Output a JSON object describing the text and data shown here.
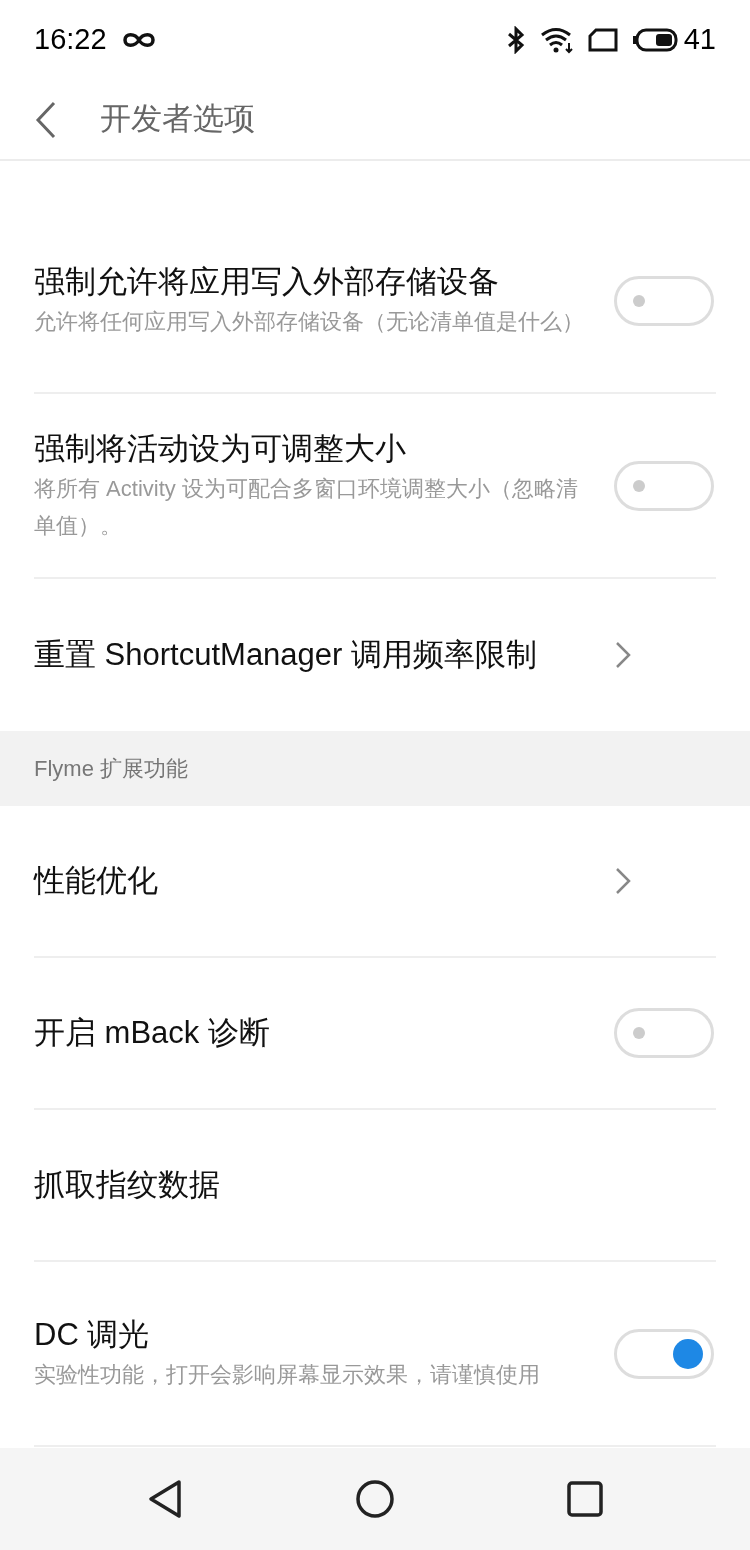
{
  "status_bar": {
    "time": "16:22",
    "battery": "41"
  },
  "header": {
    "title": "开发者选项"
  },
  "sections": [
    {
      "items": [
        {
          "kind": "toggle",
          "title": "强制允许将应用写入外部存储设备",
          "subtitle": "允许将任何应用写入外部存储设备（无论清单值是什么）",
          "on": false
        },
        {
          "kind": "toggle",
          "title": "强制将活动设为可调整大小",
          "subtitle": "将所有 Activity 设为可配合多窗口环境调整大小（忽略清单值）。",
          "on": false
        },
        {
          "kind": "link",
          "title": "重置 ShortcutManager 调用频率限制"
        }
      ]
    },
    {
      "header": "Flyme 扩展功能",
      "items": [
        {
          "kind": "link",
          "title": "性能优化"
        },
        {
          "kind": "toggle",
          "title": "开启 mBack 诊断",
          "on": false
        },
        {
          "kind": "plain",
          "title": "抓取指纹数据"
        },
        {
          "kind": "toggle",
          "title": "DC 调光",
          "subtitle": "实验性功能，打开会影响屏幕显示效果，请谨慎使用",
          "on": true
        }
      ]
    }
  ]
}
